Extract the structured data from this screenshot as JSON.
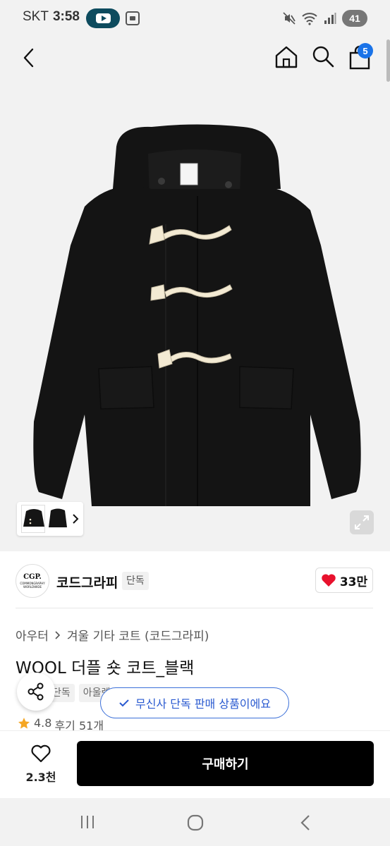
{
  "status_bar": {
    "carrier": "SKT",
    "time": "3:58",
    "battery": "41"
  },
  "header": {
    "cart_count": "5"
  },
  "brand": {
    "logo_text": "CGP.",
    "logo_subtext": "COMMONGRAPHY WORLDWIDE",
    "name": "코드그라피",
    "exclusive_label": "단독",
    "likes": "33만"
  },
  "product": {
    "breadcrumb": [
      "아우터",
      "겨울 기타 코트 (코드그라피)"
    ],
    "title": "WOOL 더플 숏 코트_블랙",
    "tags": [
      "단독",
      "아울렛"
    ],
    "rating": "4.8",
    "reviews": "후기 51개"
  },
  "toast": {
    "text": "무신사 단독 판매 상품이에요"
  },
  "action_bar": {
    "wish_count": "2.3천",
    "buy_label": "구매하기"
  },
  "colors": {
    "accent": "#1a73e8",
    "toast_blue": "#2a5ad0",
    "heart": "#e8112d",
    "star": "#f5a623",
    "coat": "#151515",
    "toggle": "#f3ead3"
  }
}
